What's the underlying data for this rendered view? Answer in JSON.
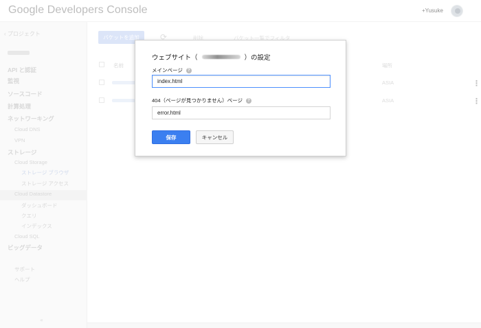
{
  "header": {
    "logo": "Google Developers Console",
    "user_name": "+Yusuke"
  },
  "sidebar": {
    "project_link": "‹ プロジェクト",
    "items": [
      {
        "label": "API と認証",
        "level": 1
      },
      {
        "label": "監視",
        "level": 1
      },
      {
        "label": "ソースコード",
        "level": 1
      },
      {
        "label": "計算処理",
        "level": 1
      },
      {
        "label": "ネットワーキング",
        "level": 1
      },
      {
        "label": "Cloud DNS",
        "level": 2
      },
      {
        "label": "VPN",
        "level": 2
      },
      {
        "label": "ストレージ",
        "level": 1
      },
      {
        "label": "Cloud Storage",
        "level": 2
      },
      {
        "label": "ストレージ ブラウザ",
        "level": 3,
        "selected": true
      },
      {
        "label": "ストレージ アクセス",
        "level": 3
      },
      {
        "label": "Cloud Datastore",
        "level": 2
      },
      {
        "label": "ダッシュボード",
        "level": 3
      },
      {
        "label": "クエリ",
        "level": 3
      },
      {
        "label": "インデックス",
        "level": 3
      },
      {
        "label": "Cloud SQL",
        "level": 2
      },
      {
        "label": "ビッグデータ",
        "level": 1
      },
      {
        "label": "サポート",
        "level": 2
      },
      {
        "label": "ヘルプ",
        "level": 2
      }
    ],
    "collapse_icon": "«"
  },
  "toolbar": {
    "add_bucket_label": "バケットを追加",
    "refresh_icon": "⟳",
    "delete_label": "削除",
    "filter_label": "バケット一覧でフィルタ"
  },
  "table": {
    "col_name": "名前",
    "col_location": "場所",
    "rows": [
      {
        "location": "ASIA"
      },
      {
        "location": "ASIA"
      }
    ],
    "more_icon": "⋮"
  },
  "dialog": {
    "title_prefix": "ウェブサイト（",
    "title_suffix": "）の設定",
    "main_page_label": "メインページ",
    "main_page_value": "index.html",
    "not_found_label": "404（ページが見つかりません）ページ",
    "not_found_value": "error.html",
    "help_icon": "?",
    "save_label": "保存",
    "cancel_label": "キャンセル"
  },
  "colors": {
    "primary_button": "#3b7ff0",
    "focus_border": "#4d90fe",
    "sidebar_bg": "#f7f7f7"
  }
}
